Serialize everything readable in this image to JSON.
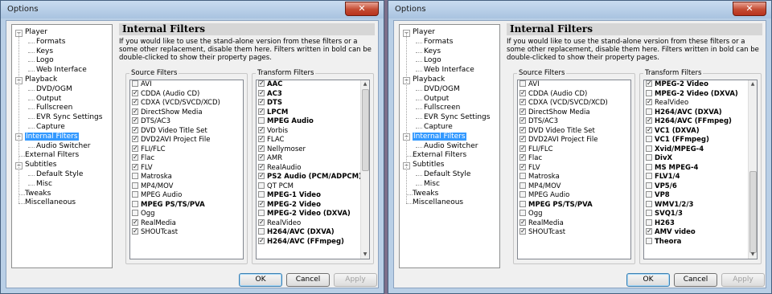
{
  "windows": [
    {
      "title": "Options",
      "close_glyph": "✕",
      "tree": [
        {
          "label": "Player",
          "level": 0,
          "expander": "−"
        },
        {
          "label": "Formats",
          "level": 1
        },
        {
          "label": "Keys",
          "level": 1
        },
        {
          "label": "Logo",
          "level": 1
        },
        {
          "label": "Web Interface",
          "level": 1
        },
        {
          "label": "Playback",
          "level": 0,
          "expander": "−"
        },
        {
          "label": "DVD/OGM",
          "level": 1
        },
        {
          "label": "Output",
          "level": 1
        },
        {
          "label": "Fullscreen",
          "level": 1
        },
        {
          "label": "EVR Sync Settings",
          "level": 1
        },
        {
          "label": "Capture",
          "level": 1
        },
        {
          "label": "Internal Filters",
          "level": 0,
          "expander": "−",
          "selected": true
        },
        {
          "label": "Audio Switcher",
          "level": 1
        },
        {
          "label": "External Filters",
          "level": 0
        },
        {
          "label": "Subtitles",
          "level": 0,
          "expander": "−"
        },
        {
          "label": "Default Style",
          "level": 1
        },
        {
          "label": "Misc",
          "level": 1
        },
        {
          "label": "Tweaks",
          "level": 0
        },
        {
          "label": "Miscellaneous",
          "level": 0
        }
      ],
      "panel_title": "Internal Filters",
      "description": "If you would like to use the stand-alone version from these filters or a some other replacement, disable them here. Filters written in bold can be double-clicked to show their property pages.",
      "source_label": "Source Filters",
      "transform_label": "Transform Filters",
      "source_filters": [
        {
          "label": "AVI",
          "checked": false,
          "bold": false
        },
        {
          "label": "CDDA (Audio CD)",
          "checked": true,
          "bold": false
        },
        {
          "label": "CDXA (VCD/SVCD/XCD)",
          "checked": true,
          "bold": false
        },
        {
          "label": "DirectShow Media",
          "checked": true,
          "bold": false
        },
        {
          "label": "DTS/AC3",
          "checked": true,
          "bold": false
        },
        {
          "label": "DVD Video Title Set",
          "checked": true,
          "bold": false
        },
        {
          "label": "DVD2AVI Project File",
          "checked": true,
          "bold": false
        },
        {
          "label": "FLI/FLC",
          "checked": true,
          "bold": false
        },
        {
          "label": "Flac",
          "checked": true,
          "bold": false
        },
        {
          "label": "FLV",
          "checked": true,
          "bold": false
        },
        {
          "label": "Matroska",
          "checked": false,
          "bold": false
        },
        {
          "label": "MP4/MOV",
          "checked": false,
          "bold": false
        },
        {
          "label": "MPEG Audio",
          "checked": false,
          "bold": false
        },
        {
          "label": "MPEG PS/TS/PVA",
          "checked": false,
          "bold": true
        },
        {
          "label": "Ogg",
          "checked": false,
          "bold": false
        },
        {
          "label": "RealMedia",
          "checked": true,
          "bold": false
        },
        {
          "label": "SHOUTcast",
          "checked": true,
          "bold": false
        }
      ],
      "transform_filters": [
        {
          "label": "AAC",
          "checked": true,
          "bold": true
        },
        {
          "label": "AC3",
          "checked": true,
          "bold": true
        },
        {
          "label": "DTS",
          "checked": true,
          "bold": true
        },
        {
          "label": "LPCM",
          "checked": true,
          "bold": true
        },
        {
          "label": "MPEG Audio",
          "checked": false,
          "bold": true
        },
        {
          "label": "Vorbis",
          "checked": true,
          "bold": false
        },
        {
          "label": "FLAC",
          "checked": true,
          "bold": false
        },
        {
          "label": "Nellymoser",
          "checked": true,
          "bold": false
        },
        {
          "label": "AMR",
          "checked": true,
          "bold": false
        },
        {
          "label": "RealAudio",
          "checked": true,
          "bold": false
        },
        {
          "label": "PS2 Audio (PCM/ADPCM)",
          "checked": true,
          "bold": true
        },
        {
          "label": "QT PCM",
          "checked": false,
          "bold": false
        },
        {
          "label": "MPEG-1 Video",
          "checked": false,
          "bold": true
        },
        {
          "label": "MPEG-2 Video",
          "checked": true,
          "bold": true
        },
        {
          "label": "MPEG-2 Video (DXVA)",
          "checked": false,
          "bold": true
        },
        {
          "label": "RealVideo",
          "checked": true,
          "bold": false
        },
        {
          "label": "H264/AVC (DXVA)",
          "checked": false,
          "bold": true
        },
        {
          "label": "H264/AVC (FFmpeg)",
          "checked": true,
          "bold": true
        }
      ],
      "transform_scroll_position": 0,
      "ok_label": "OK",
      "cancel_label": "Cancel",
      "apply_label": "Apply"
    },
    {
      "title": "Options",
      "close_glyph": "✕",
      "tree": [
        {
          "label": "Player",
          "level": 0,
          "expander": "−"
        },
        {
          "label": "Formats",
          "level": 1
        },
        {
          "label": "Keys",
          "level": 1
        },
        {
          "label": "Logo",
          "level": 1
        },
        {
          "label": "Web Interface",
          "level": 1
        },
        {
          "label": "Playback",
          "level": 0,
          "expander": "−"
        },
        {
          "label": "DVD/OGM",
          "level": 1
        },
        {
          "label": "Output",
          "level": 1
        },
        {
          "label": "Fullscreen",
          "level": 1
        },
        {
          "label": "EVR Sync Settings",
          "level": 1
        },
        {
          "label": "Capture",
          "level": 1
        },
        {
          "label": "Internal Filters",
          "level": 0,
          "expander": "−",
          "selected": true
        },
        {
          "label": "Audio Switcher",
          "level": 1
        },
        {
          "label": "External Filters",
          "level": 0
        },
        {
          "label": "Subtitles",
          "level": 0,
          "expander": "−"
        },
        {
          "label": "Default Style",
          "level": 1
        },
        {
          "label": "Misc",
          "level": 1
        },
        {
          "label": "Tweaks",
          "level": 0
        },
        {
          "label": "Miscellaneous",
          "level": 0
        }
      ],
      "panel_title": "Internal Filters",
      "description": "If you would like to use the stand-alone version from these filters or a some other replacement, disable them here. Filters written in bold can be double-clicked to show their property pages.",
      "source_label": "Source Filters",
      "transform_label": "Transform Filters",
      "source_filters": [
        {
          "label": "AVI",
          "checked": false,
          "bold": false
        },
        {
          "label": "CDDA (Audio CD)",
          "checked": true,
          "bold": false
        },
        {
          "label": "CDXA (VCD/SVCD/XCD)",
          "checked": true,
          "bold": false
        },
        {
          "label": "DirectShow Media",
          "checked": true,
          "bold": false
        },
        {
          "label": "DTS/AC3",
          "checked": true,
          "bold": false
        },
        {
          "label": "DVD Video Title Set",
          "checked": true,
          "bold": false
        },
        {
          "label": "DVD2AVI Project File",
          "checked": true,
          "bold": false
        },
        {
          "label": "FLI/FLC",
          "checked": true,
          "bold": false
        },
        {
          "label": "Flac",
          "checked": true,
          "bold": false
        },
        {
          "label": "FLV",
          "checked": true,
          "bold": false
        },
        {
          "label": "Matroska",
          "checked": false,
          "bold": false
        },
        {
          "label": "MP4/MOV",
          "checked": false,
          "bold": false
        },
        {
          "label": "MPEG Audio",
          "checked": false,
          "bold": false
        },
        {
          "label": "MPEG PS/TS/PVA",
          "checked": false,
          "bold": true
        },
        {
          "label": "Ogg",
          "checked": false,
          "bold": false
        },
        {
          "label": "RealMedia",
          "checked": true,
          "bold": false
        },
        {
          "label": "SHOUTcast",
          "checked": true,
          "bold": false
        }
      ],
      "transform_filters": [
        {
          "label": "MPEG-2 Video",
          "checked": true,
          "bold": true
        },
        {
          "label": "MPEG-2 Video (DXVA)",
          "checked": false,
          "bold": true
        },
        {
          "label": "RealVideo",
          "checked": true,
          "bold": false
        },
        {
          "label": "H264/AVC (DXVA)",
          "checked": false,
          "bold": true
        },
        {
          "label": "H264/AVC (FFmpeg)",
          "checked": true,
          "bold": true
        },
        {
          "label": "VC1 (DXVA)",
          "checked": true,
          "bold": true
        },
        {
          "label": "VC1 (FFmpeg)",
          "checked": false,
          "bold": true
        },
        {
          "label": "Xvid/MPEG-4",
          "checked": false,
          "bold": true
        },
        {
          "label": "DivX",
          "checked": false,
          "bold": true
        },
        {
          "label": "MS MPEG-4",
          "checked": false,
          "bold": true
        },
        {
          "label": "FLV1/4",
          "checked": false,
          "bold": true
        },
        {
          "label": "VP5/6",
          "checked": false,
          "bold": true
        },
        {
          "label": "VP8",
          "checked": false,
          "bold": true
        },
        {
          "label": "WMV1/2/3",
          "checked": false,
          "bold": true
        },
        {
          "label": "SVQ1/3",
          "checked": false,
          "bold": true
        },
        {
          "label": "H263",
          "checked": false,
          "bold": true
        },
        {
          "label": "AMV video",
          "checked": true,
          "bold": true
        },
        {
          "label": "Theora",
          "checked": false,
          "bold": true
        }
      ],
      "transform_scroll_position": 1,
      "ok_label": "OK",
      "cancel_label": "Cancel",
      "apply_label": "Apply"
    }
  ]
}
